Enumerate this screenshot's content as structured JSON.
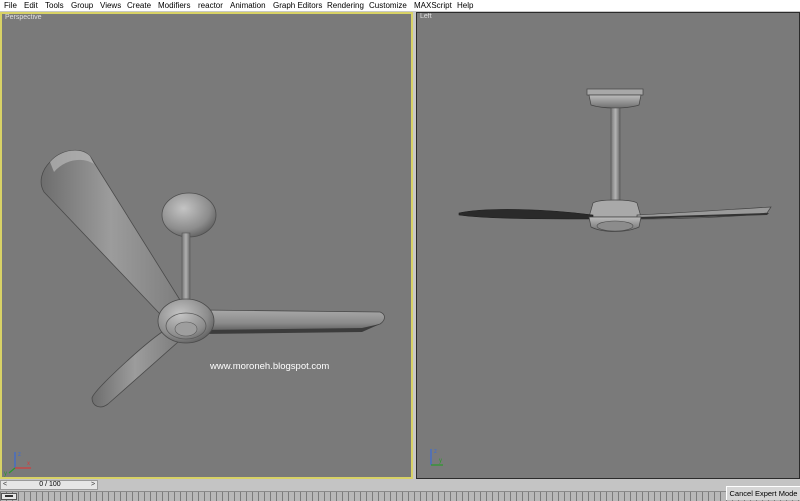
{
  "menu": [
    "File",
    "Edit",
    "Tools",
    "Group",
    "Views",
    "Create",
    "Modifiers",
    "reactor",
    "Animation",
    "Graph Editors",
    "Rendering",
    "Customize",
    "MAXScript",
    "Help"
  ],
  "viewports": {
    "perspective": {
      "label": "Perspective",
      "watermark": "www.moroneh.blogspot.com"
    },
    "left": {
      "label": "Left"
    }
  },
  "axis_labels": {
    "x": "x",
    "y": "y",
    "z": "z"
  },
  "timeline": {
    "frame": "0 / 100",
    "prev_arrow": "<",
    "next_arrow": ">"
  },
  "status": {
    "expert_button": "Cancel Expert Mode"
  },
  "colors": {
    "active_viewport_border": "#d8d266",
    "viewport_bg": "#7a7a7a"
  }
}
